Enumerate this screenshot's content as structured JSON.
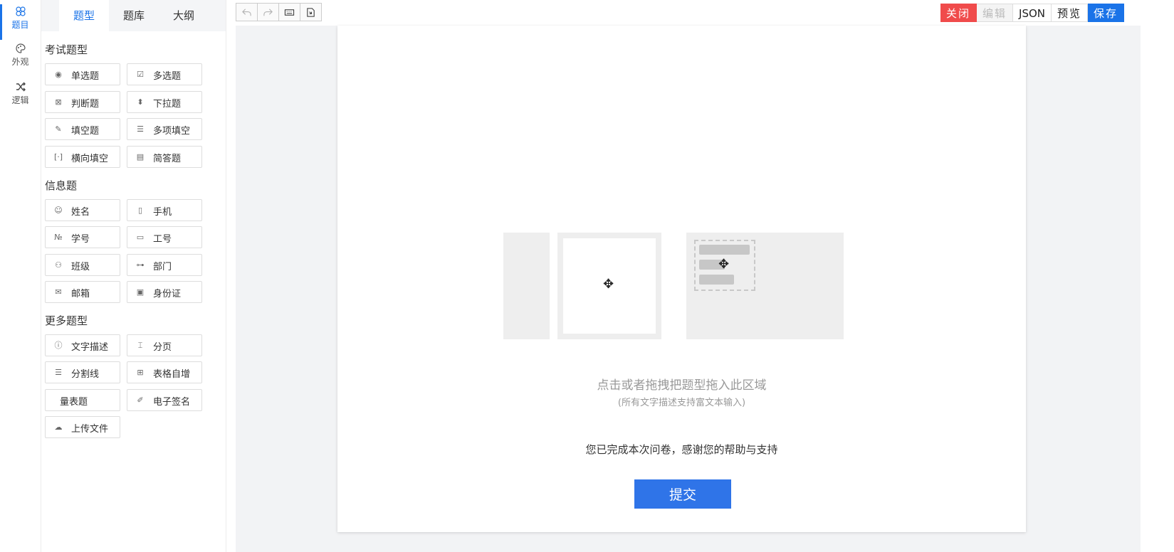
{
  "rail": {
    "items": [
      {
        "label": "题目",
        "icon": "question-icon",
        "active": true
      },
      {
        "label": "外观",
        "icon": "palette-icon"
      },
      {
        "label": "逻辑",
        "icon": "shuffle-icon"
      }
    ]
  },
  "tabs": [
    "题型",
    "题库",
    "大纲"
  ],
  "groups": {
    "exam": {
      "title": "考试题型",
      "items": [
        "单选题",
        "多选题",
        "判断题",
        "下拉题",
        "填空题",
        "多项填空",
        "横向填空",
        "简答题"
      ]
    },
    "info": {
      "title": "信息题",
      "items": [
        "姓名",
        "手机",
        "学号",
        "工号",
        "班级",
        "部门",
        "邮箱",
        "身份证"
      ]
    },
    "more": {
      "title": "更多题型",
      "items": [
        "文字描述",
        "分页",
        "分割线",
        "表格自增",
        "量表题",
        "电子签名",
        "上传文件"
      ]
    }
  },
  "actions": {
    "close": "关闭",
    "edit": "编辑",
    "json": "JSON",
    "preview": "预览",
    "save": "保存"
  },
  "canvas": {
    "hint": "点击或者拖拽把题型拖入此区域",
    "hint_sub": "(所有文字描述支持富文本输入)",
    "thanks": "您已完成本次问卷，感谢您的帮助与支持",
    "submit": "提交"
  },
  "colors": {
    "accent": "#1a73e8",
    "close": "#f04b4b"
  }
}
